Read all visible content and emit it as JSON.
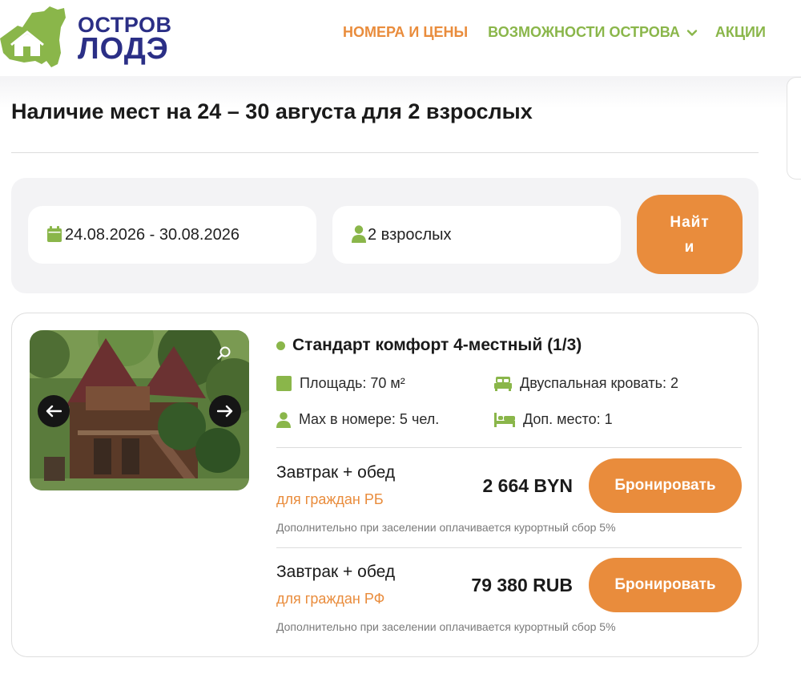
{
  "header": {
    "logo_line1": "ОСТРОВ",
    "logo_line2": "ЛОДЭ",
    "nav": {
      "prices": "НОМЕРА И ЦЕНЫ",
      "features": "ВОЗМОЖНОСТИ ОСТРОВА",
      "promos": "АКЦИИ"
    }
  },
  "page_title": "Наличие мест на 24 – 30 августа для 2 взрослых",
  "search": {
    "dates": "24.08.2026 - 30.08.2026",
    "guests": "2 взрослых",
    "button_line1": "Найт",
    "button_line2": "и"
  },
  "room": {
    "title": "Стандарт комфорт 4-местный (1/3)",
    "features": {
      "area": "Площадь: 70 м²",
      "beds": "Двуспальная кровать: 2",
      "max": "Max в номере: 5 чел.",
      "extra": "Доп. место: 1"
    },
    "rates": [
      {
        "name": "Завтрак + обед",
        "sub": "для граждан РБ",
        "price": "2 664 BYN",
        "button": "Бронировать",
        "note": "Дополнительно при заселении оплачивается курортный сбор 5%"
      },
      {
        "name": "Завтрак + обед",
        "sub": "для граждан РФ",
        "price": "79 380 RUB",
        "button": "Бронировать",
        "note": "Дополнительно при заселении оплачивается курортный сбор 5%"
      }
    ]
  },
  "colors": {
    "accent_orange": "#e98c3c",
    "accent_green": "#8ab64a",
    "logo_blue": "#2b2f86",
    "panel_grey": "#f3f3f5"
  },
  "icons": {
    "calendar": "calendar-icon",
    "person": "person-icon",
    "area": "area-square-icon",
    "bed": "double-bed-icon",
    "extra_bed": "extra-bed-icon",
    "zoom": "zoom-icon",
    "prev": "arrow-left-icon",
    "next": "arrow-right-icon",
    "chevron": "chevron-down-icon"
  }
}
